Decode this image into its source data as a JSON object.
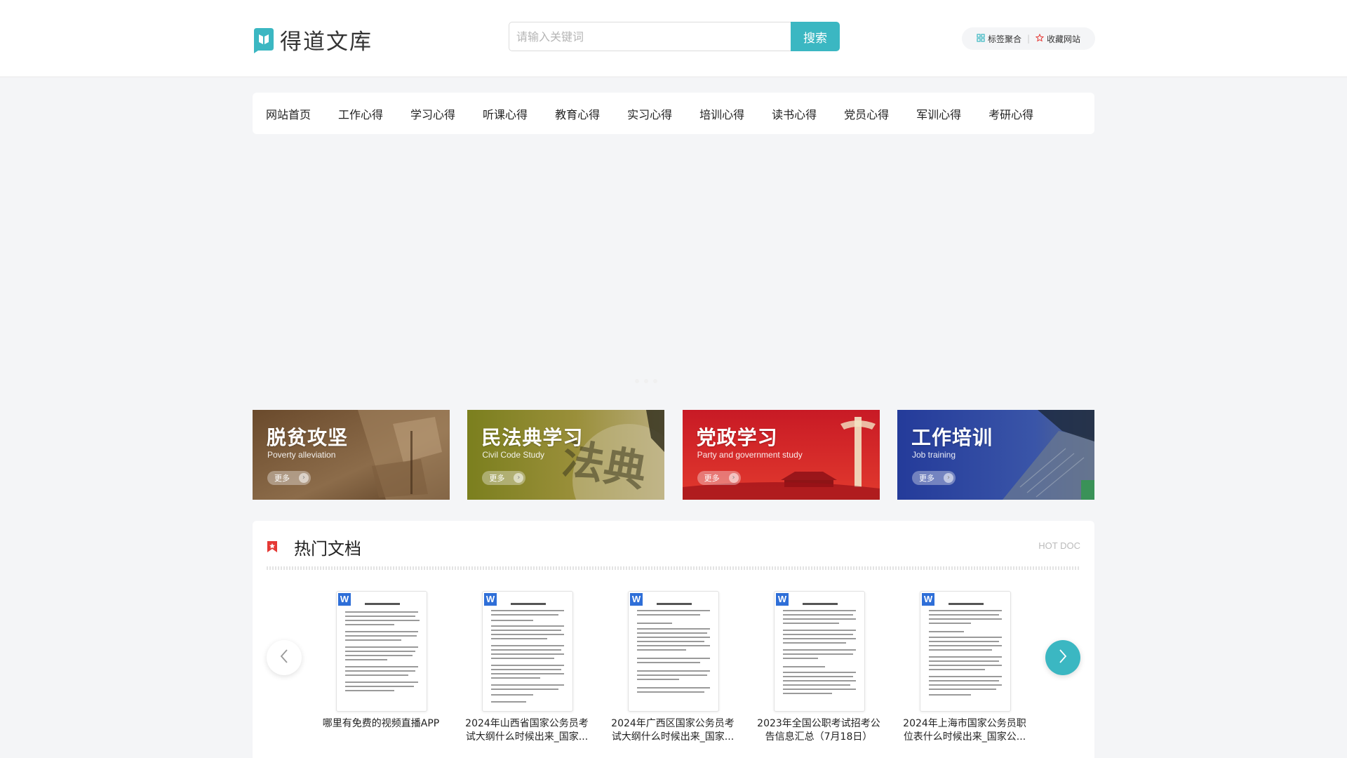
{
  "header": {
    "logo_text": "得道文库",
    "search_placeholder": "请输入关键词",
    "search_button": "搜索",
    "tag_link": "标签聚合",
    "favorite_link": "收藏网站"
  },
  "nav": {
    "items": [
      "网站首页",
      "工作心得",
      "学习心得",
      "听课心得",
      "教育心得",
      "实习心得",
      "培训心得",
      "读书心得",
      "党员心得",
      "军训心得",
      "考研心得"
    ]
  },
  "cards": [
    {
      "title": "脱贫攻坚",
      "subtitle": "Poverty alleviation",
      "more": "更多",
      "color": "#7a5a3a"
    },
    {
      "title": "民法典学习",
      "subtitle": "Civil Code Study",
      "more": "更多",
      "color": "#8a8a2a"
    },
    {
      "title": "党政学习",
      "subtitle": "Party and government study",
      "more": "更多",
      "color": "#c8202a"
    },
    {
      "title": "工作培训",
      "subtitle": "Job training",
      "more": "更多",
      "color": "#2a3f9a"
    }
  ],
  "hot": {
    "title": "热门文档",
    "title_en": "HOT DOC",
    "docs": [
      {
        "name_line1": "哪里有免费的视频直播APP",
        "name_line2": "",
        "badge": "W"
      },
      {
        "name_line1": "2024年山西省国家公务员考",
        "name_line2": "试大纲什么时候出来_国家...",
        "badge": "W"
      },
      {
        "name_line1": "2024年广西区国家公务员考",
        "name_line2": "试大纲什么时候出来_国家...",
        "badge": "W"
      },
      {
        "name_line1": "2023年全国公职考试招考公",
        "name_line2": "告信息汇总（7月18日）",
        "badge": "W"
      },
      {
        "name_line1": "2024年上海市国家公务员职",
        "name_line2": "位表什么时候出来_国家公...",
        "badge": "W"
      }
    ]
  },
  "colors": {
    "accent": "#3bb7c2",
    "hot_icon": "#e53935"
  }
}
